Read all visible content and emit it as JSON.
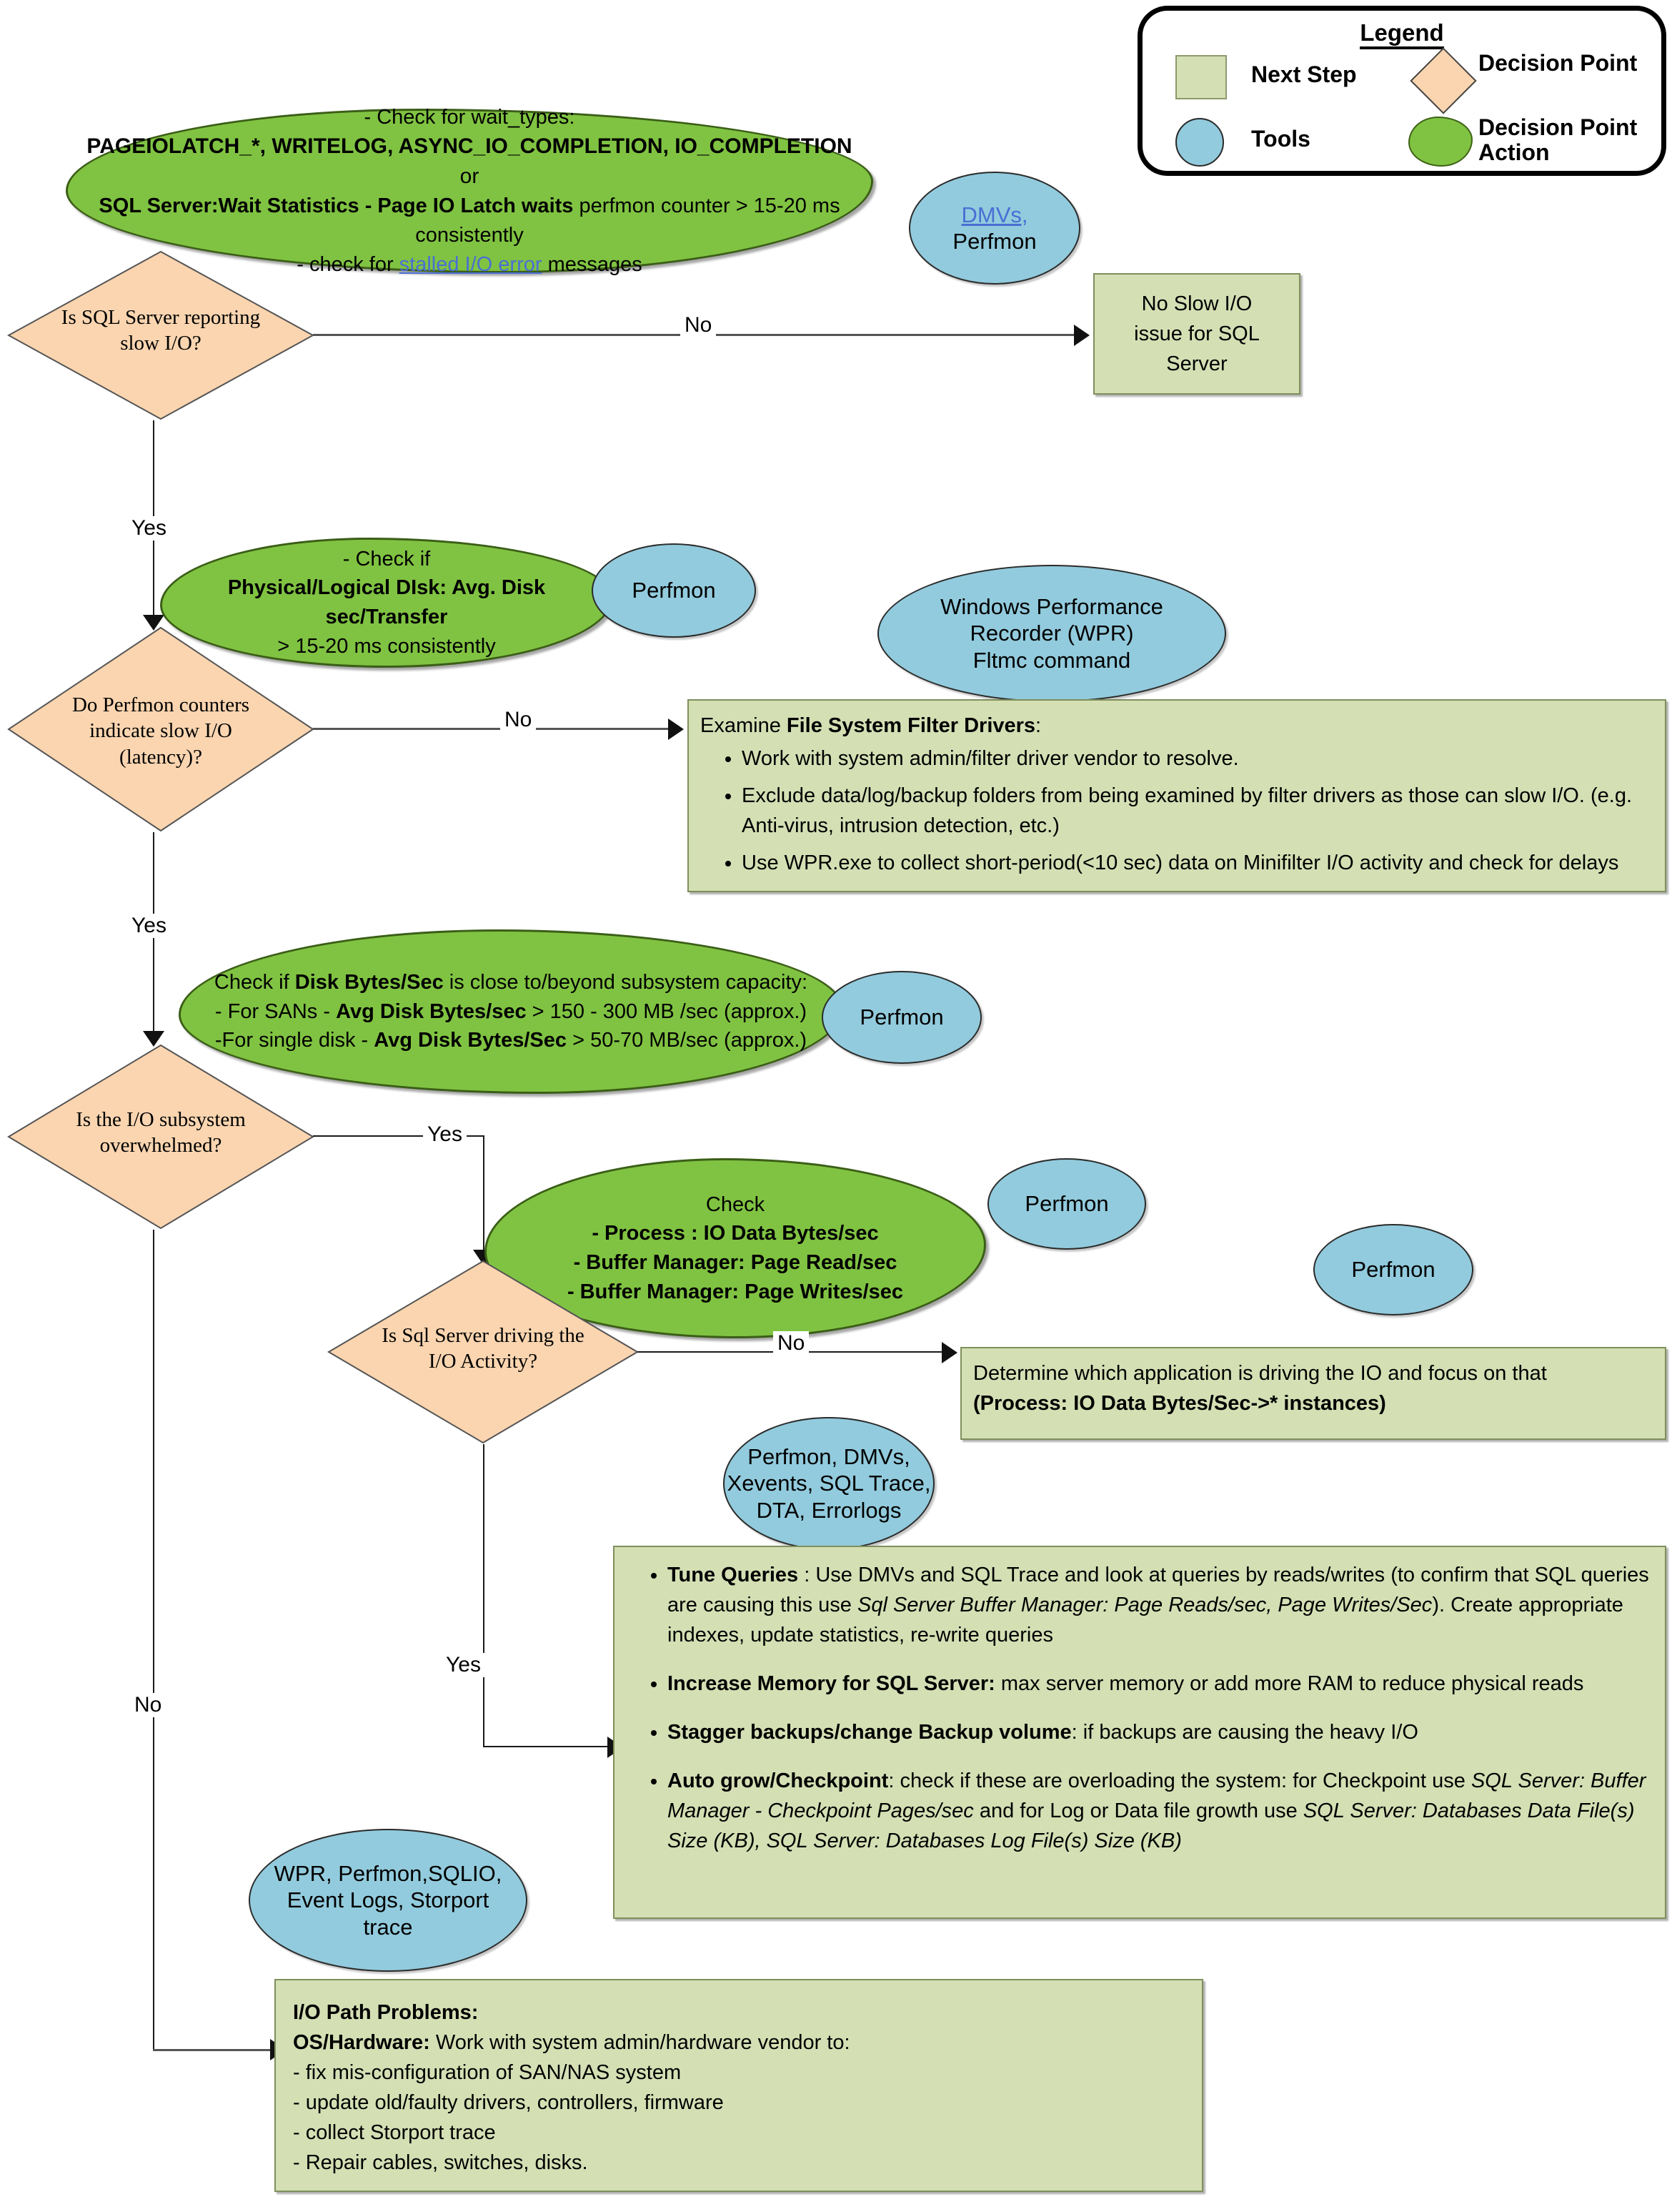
{
  "legend": {
    "title": "Legend",
    "items": [
      {
        "key": "next_step",
        "label": "Next Step",
        "shape": "rectangle",
        "color": "#d4dfb4"
      },
      {
        "key": "tools",
        "label": "Tools",
        "shape": "circle",
        "color": "#92cbdd"
      },
      {
        "key": "decision_point",
        "label": "Decision Point",
        "shape": "diamond",
        "color": "#fad5b0"
      },
      {
        "key": "decision_point_action",
        "label": "Decision Point Action",
        "shape": "cloud",
        "color": "#80c342"
      }
    ]
  },
  "clouds": {
    "wait_types": {
      "l1": "- Check for wait_types:",
      "l2a": "PAGEIOLATCH_*,  WRITELOG, ASYNC_IO_COMPLETION, IO_COMPLETION",
      "l2b": " or",
      "l3a": "SQL Server:Wait Statistics - Page IO Latch waits",
      "l3b": " perfmon counter > 15-20 ms",
      "l4": "consistently",
      "l5a": "- check for ",
      "l5b": "stalled I/O error",
      "l5c": " messages"
    },
    "disk_latency": {
      "l1": "- Check if",
      "l2": "Physical/Logical DIsk: Avg. Disk sec/Transfer",
      "l3": "> 15-20 ms consistently"
    },
    "disk_bytes": {
      "l1a": "Check if ",
      "l1b": "Disk Bytes/Sec",
      "l1c": " is close to/beyond subsystem capacity:",
      "l2a": "- For SANs - ",
      "l2b": "Avg Disk Bytes/sec",
      "l2c": " > 150 - 300 MB /sec   (approx.)",
      "l3a": "-For single disk - ",
      "l3b": "Avg Disk Bytes/Sec",
      "l3c": " > 50-70 MB/sec (approx.)"
    },
    "sql_driving": {
      "l1": "Check",
      "l2": "- Process : IO Data Bytes/sec",
      "l3": "- Buffer Manager: Page Read/sec",
      "l4": "- Buffer Manager: Page Writes/sec"
    }
  },
  "tools": {
    "dmvs_perfmon": {
      "l1": "DMVs,",
      "l2": "Perfmon"
    },
    "perfmon_1": "Perfmon",
    "wpr": {
      "l1": "Windows Performance",
      "l2": "Recorder (WPR)",
      "l3": "Fltmc command"
    },
    "perfmon_2": "Perfmon",
    "perfmon_3": "Perfmon",
    "perfmon_4": "Perfmon",
    "sql_tools": {
      "l1": "Perfmon, DMVs,",
      "l2": "Xevents, SQL Trace,",
      "l3": "DTA, Errorlogs"
    },
    "wpr_tools": {
      "l1": "WPR, Perfmon,SQLIO,",
      "l2": "Event Logs, Storport",
      "l3": "trace"
    }
  },
  "decisions": {
    "d1": {
      "l1": "Is SQL Server reporting",
      "l2": "slow I/O?"
    },
    "d2": {
      "l1": "Do Perfmon counters",
      "l2": "indicate slow I/O",
      "l3": "(latency)?"
    },
    "d3": {
      "l1": "Is the I/O subsystem",
      "l2": "overwhelmed?"
    },
    "d4": {
      "l1": "Is Sql Server driving the",
      "l2": "I/O Activity?"
    }
  },
  "edges": {
    "e1_no": "No",
    "e1_yes": "Yes",
    "e2_no": "No",
    "e2_yes": "Yes",
    "e3_yes": "Yes",
    "e3_no": "No",
    "e4_no": "No",
    "e4_yes": "Yes"
  },
  "boxes": {
    "no_slow_io": {
      "l1": "No Slow I/O",
      "l2": "issue for SQL",
      "l3": "Server"
    },
    "filter_drivers": {
      "title_a": "Examine ",
      "title_b": "File System Filter Drivers",
      "title_c": ":",
      "bullets": [
        "Work with system admin/filter driver vendor to resolve.",
        "Exclude data/log/backup folders from being examined by filter drivers as those can slow I/O. (e.g. Anti-virus, intrusion detection, etc.)",
        "Use WPR.exe to collect short-period(<10 sec) data on Minifilter I/O activity and check for delays"
      ]
    },
    "determine_app": {
      "l1": "Determine which application is driving the IO and focus on that",
      "l2": "(Process: IO Data Bytes/Sec->* instances)"
    },
    "tune": {
      "b1_head": "Tune Queries",
      "b1_a": " : Use DMVs and SQL Trace and look at queries by reads/writes (to   confirm that SQL queries are causing this use ",
      "b1_i": "Sql Server Buffer Manager: Page Reads/sec, Page Writes/Sec",
      "b1_b": "). Create appropriate indexes, update statistics, re-write queries",
      "b2_head": "Increase Memory for SQL Server:",
      "b2_a": " max server memory or add more RAM to reduce physical reads",
      "b3_head": "Stagger backups/change Backup volume",
      "b3_a": ": if backups are causing the heavy I/O",
      "b4_head": "Auto grow/Checkpoint",
      "b4_a": ": check if these are overloading the system: for Checkpoint use ",
      "b4_i1": "SQL Server: Buffer Manager - Checkpoint Pages/sec",
      "b4_b": " and for Log or Data file growth use ",
      "b4_i2": "SQL Server: Databases Data File(s) Size (KB), SQL Server: Databases Log File(s) Size (KB)"
    },
    "io_path": {
      "title": "I/O Path Problems:",
      "subtitle_b": "OS/Hardware:",
      "subtitle_a": " Work with system admin/hardware vendor to:",
      "lines": [
        "- fix mis-configuration of SAN/NAS system",
        "- update old/faulty drivers, controllers, firmware",
        "- collect Storport trace",
        "- Repair cables, switches, disks."
      ]
    }
  },
  "colors": {
    "cloud_green": "#80c342",
    "tool_blue": "#92cbdd",
    "decision_peach": "#fad5b0",
    "step_green": "#d4dfb4",
    "line_gray": "#555555"
  }
}
